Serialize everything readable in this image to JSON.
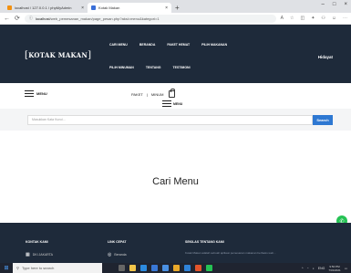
{
  "browser": {
    "tabs": [
      {
        "label": "localhost / 127.0.0.1 / phpMyAdmin",
        "favicon_color": "#f29111"
      },
      {
        "label": "Kotak Makan",
        "favicon_color": "#3a6fd8"
      }
    ],
    "new_tab": "+",
    "window_controls": [
      "–",
      "□",
      "×"
    ],
    "url_host": "localhost",
    "url_path": "/web_pemesanan_makan/page_pesan.php?aksi=menu&kategori=1",
    "back": "←",
    "reload": "⟳",
    "info": "ⓘ"
  },
  "header": {
    "logo": "KOTAK MAKAN",
    "menu_row1": [
      "CARI MENU",
      "BERANDA",
      "PAKET HEMAT",
      "PILIH MAKANAN"
    ],
    "menu_row2": [
      "PILIH MINUMAN",
      "TENTANG",
      "TESTIMONI"
    ],
    "user": "Hidayat"
  },
  "subnav": {
    "menu_label": "MENU",
    "paket": "PAKET",
    "separator": "|",
    "minum": "MINUM",
    "menu_label2": "MENU"
  },
  "search": {
    "placeholder": "Masukkan Kata Kunci...",
    "button": "Search"
  },
  "main": {
    "title": "Cari Menu"
  },
  "footer": {
    "col1_head": "KONTAK KAMI",
    "col1_item": "DKI JAKARTA",
    "col2_head": "LINK CEPAT",
    "col2_item": "Beranda",
    "col3_head": "SEKILAS TENTANG KAMI",
    "col3_text": "Kotak Makan adalah sebuah aplikasi pemesanan makanan berbasis web..."
  },
  "taskbar": {
    "search_placeholder": "Type here to search",
    "lang": "ENG",
    "time": "9:50 PM",
    "date": "7/31/2021"
  },
  "colors": {
    "brand_dark": "#1e2a3a",
    "accent": "#2e78d2",
    "chat": "#25c254"
  }
}
